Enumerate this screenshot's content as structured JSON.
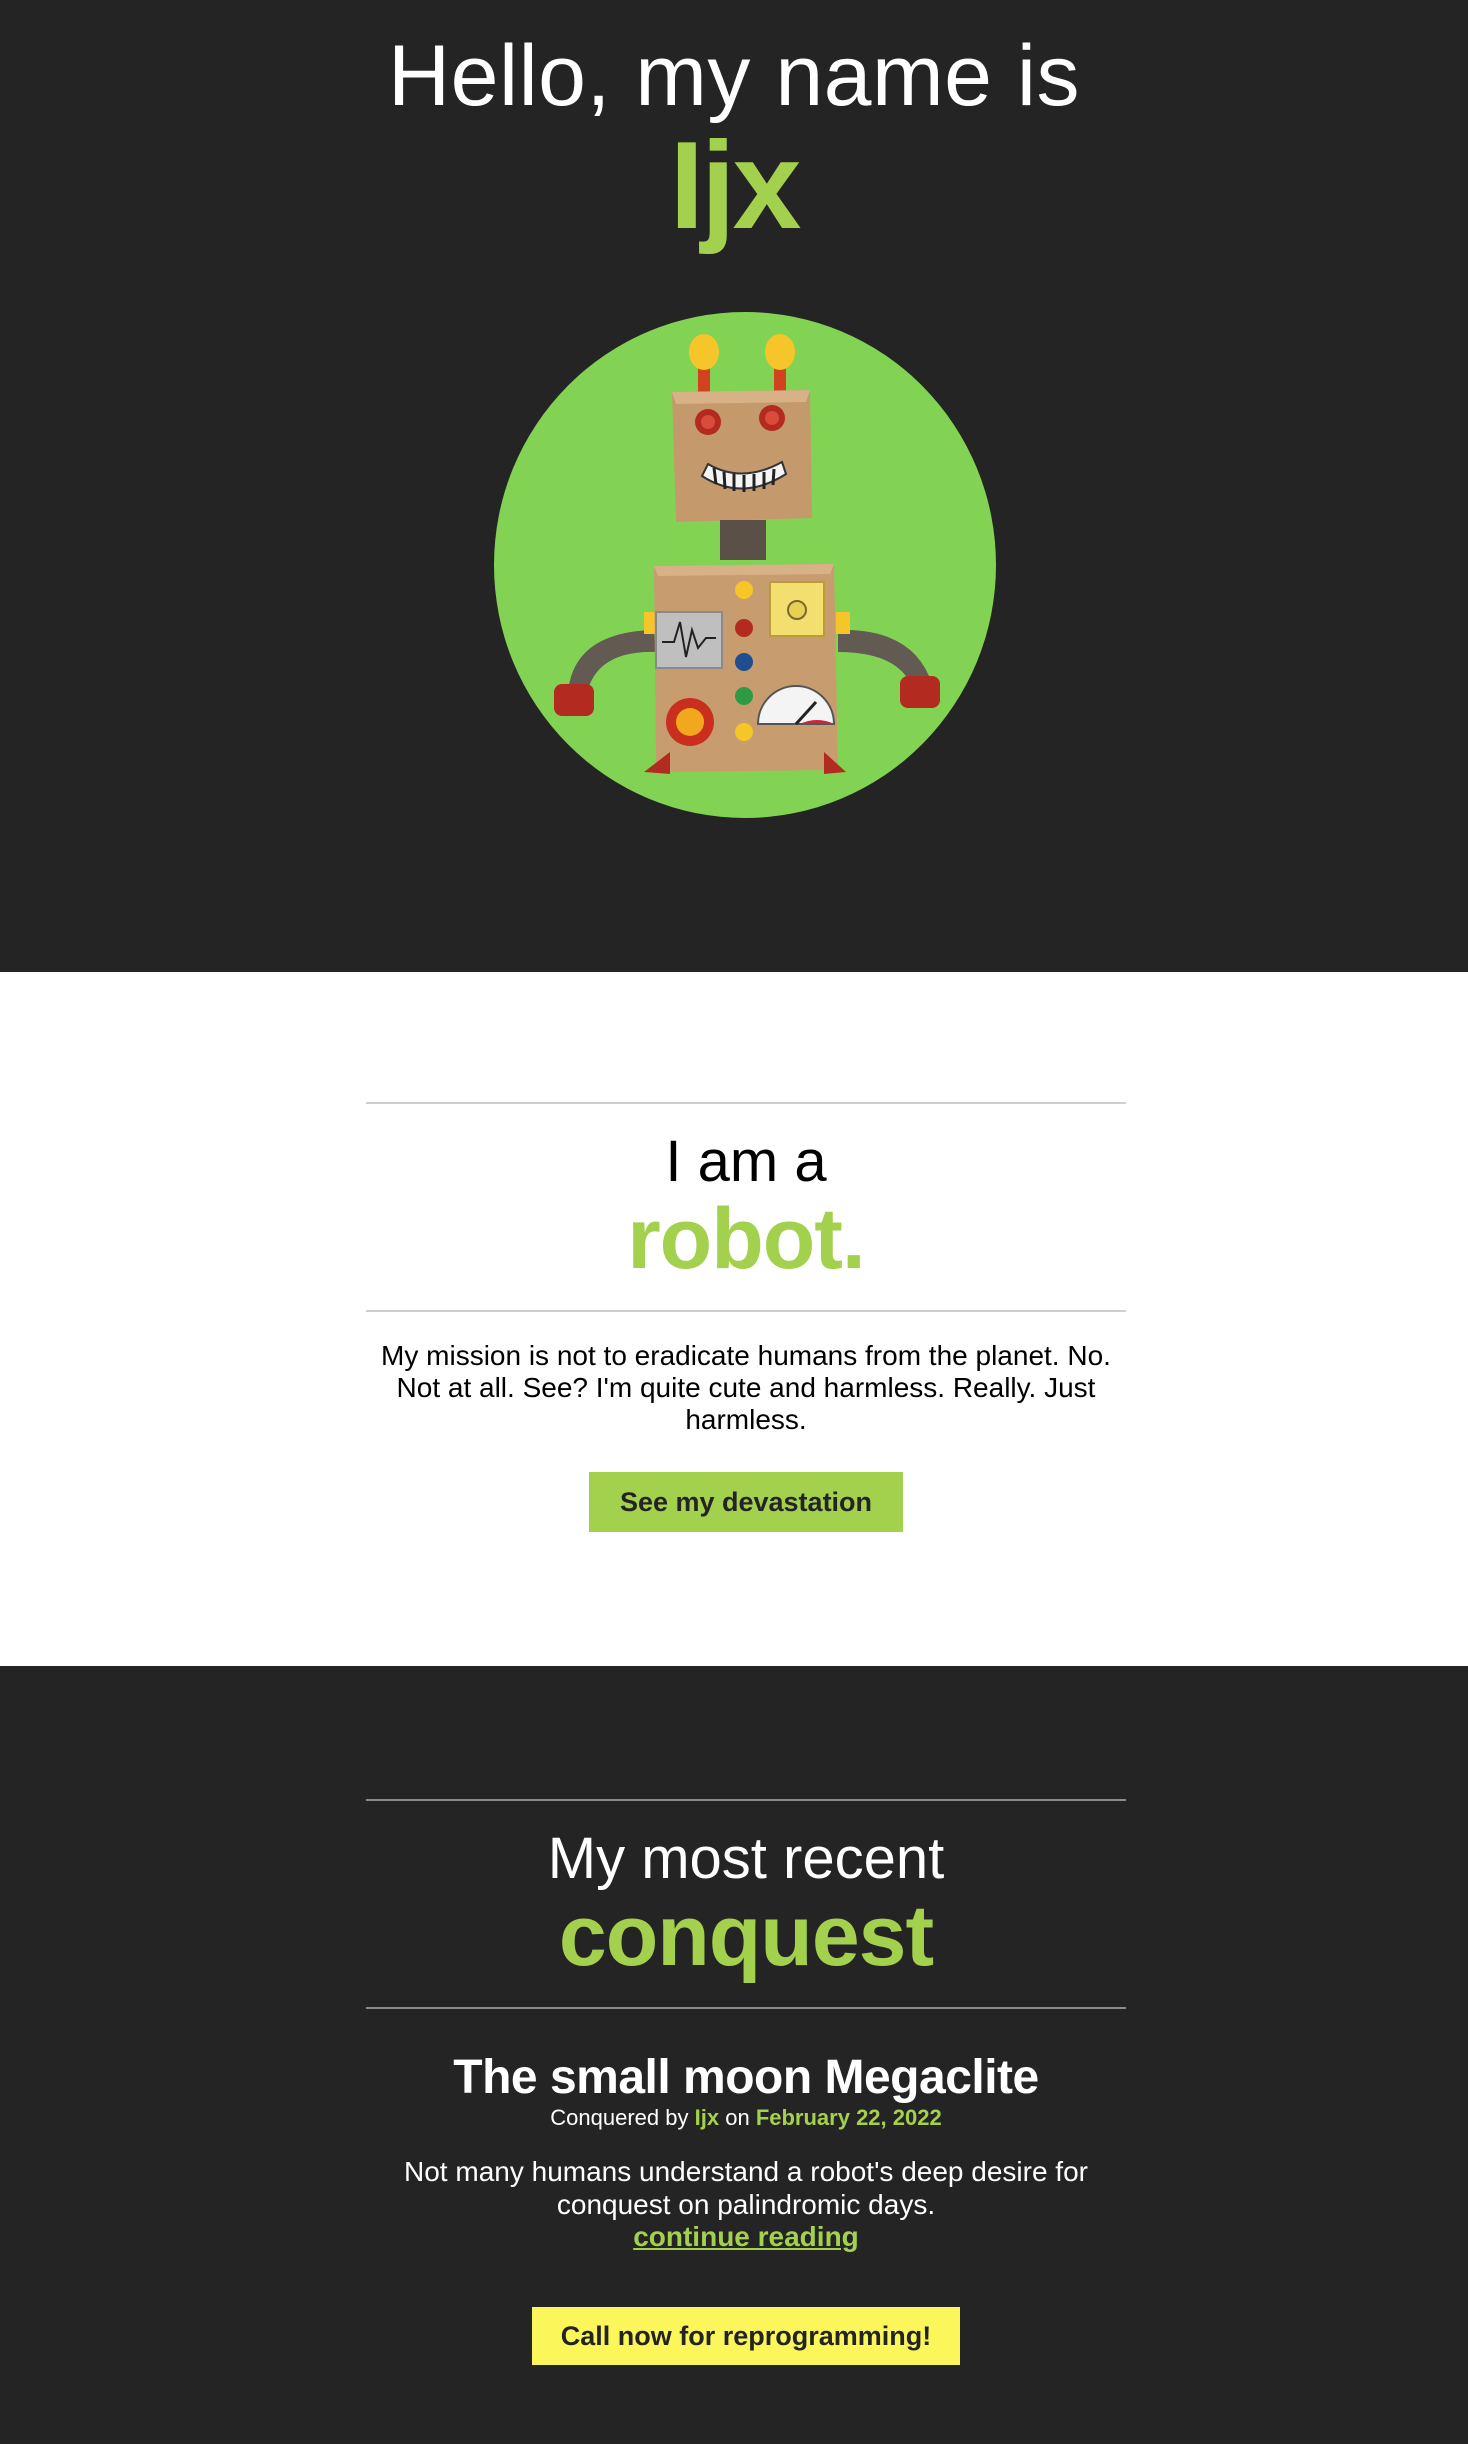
{
  "colors": {
    "accent": "#a3d14d",
    "dark_bg": "#242424",
    "light_bg": "#ffffff",
    "cta_yellow": "#fbf65a",
    "robot_circle": "#82d353"
  },
  "hero": {
    "greeting": "Hello, my name is",
    "name": "Ijx"
  },
  "about": {
    "kicker": "I am a",
    "headline": "robot.",
    "body": "My mission is not to eradicate humans from the planet. No. Not at all. See? I'm quite cute and harmless. Really. Just harmless.",
    "button_label": "See my devastation"
  },
  "recent": {
    "kicker": "My most recent",
    "headline": "conquest",
    "post": {
      "title": "The small moon Megaclite",
      "meta_prefix": "Conquered by",
      "author": "Ijx",
      "meta_on": "on",
      "date": "February 22, 2022",
      "excerpt": "Not many humans understand a robot's deep desire for conquest on palindromic days.",
      "continue_label": "continue reading"
    },
    "cta_label": "Call now for reprogramming!"
  }
}
